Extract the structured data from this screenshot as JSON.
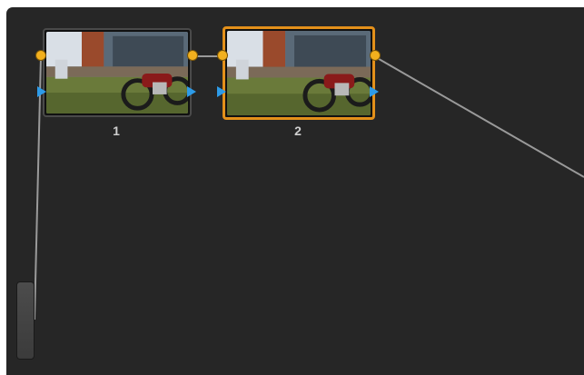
{
  "node_editor": {
    "nodes": [
      {
        "id": "1",
        "label": "1",
        "selected": false
      },
      {
        "id": "2",
        "label": "2",
        "selected": true
      }
    ]
  },
  "colors": {
    "background": "#262626",
    "selected_border": "#e3901a",
    "rgb_port": "#f2b01e",
    "key_port": "#2d9be8",
    "wire": "#9a9a9a"
  },
  "icons": {
    "rgb_port": "circle",
    "key_port": "triangle-right"
  }
}
